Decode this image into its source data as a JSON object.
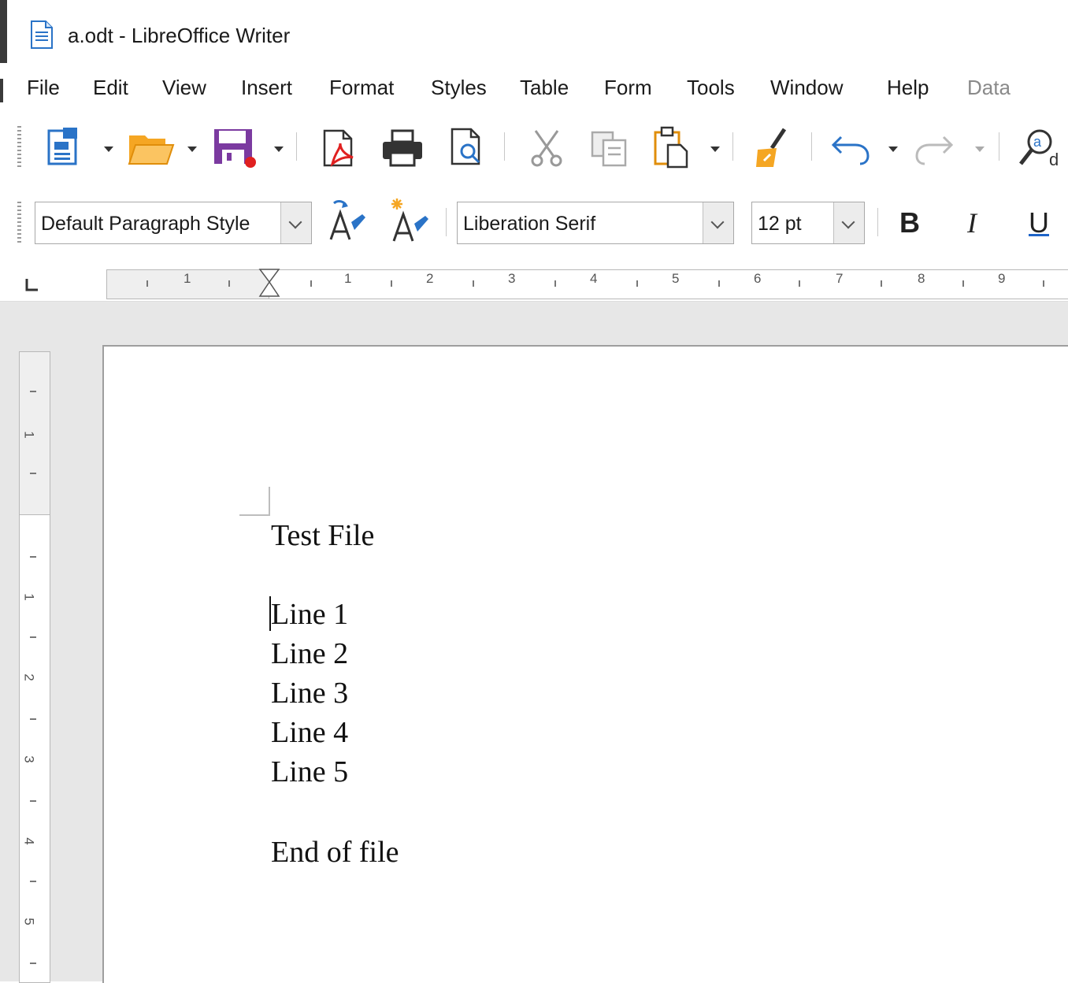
{
  "window": {
    "title": "a.odt - LibreOffice Writer",
    "app_icon": "writer-document-icon"
  },
  "menubar": {
    "items": [
      {
        "label": "File",
        "enabled": true
      },
      {
        "label": "Edit",
        "enabled": true
      },
      {
        "label": "View",
        "enabled": true
      },
      {
        "label": "Insert",
        "enabled": true
      },
      {
        "label": "Format",
        "enabled": true
      },
      {
        "label": "Styles",
        "enabled": true
      },
      {
        "label": "Table",
        "enabled": true
      },
      {
        "label": "Form",
        "enabled": true
      },
      {
        "label": "Tools",
        "enabled": true
      },
      {
        "label": "Window",
        "enabled": true
      },
      {
        "label": "Help",
        "enabled": true
      },
      {
        "label": "Data",
        "enabled": false
      }
    ]
  },
  "standard_toolbar": {
    "icons": [
      "new-document-icon",
      "open-folder-icon",
      "save-icon",
      "export-pdf-icon",
      "print-icon",
      "print-preview-icon",
      "cut-icon",
      "copy-icon",
      "paste-icon",
      "clone-formatting-icon",
      "undo-icon",
      "redo-icon",
      "find-replace-icon"
    ]
  },
  "formatting_toolbar": {
    "paragraph_style": "Default Paragraph Style",
    "font_name": "Liberation Serif",
    "font_size": "12 pt",
    "bold_label": "B",
    "italic_label": "I",
    "underline_label": "U"
  },
  "ruler": {
    "horizontal_labels": [
      "1",
      "1",
      "2",
      "3",
      "4",
      "5",
      "6",
      "7",
      "8",
      "9"
    ],
    "vertical_labels": [
      "1",
      "1",
      "2",
      "3",
      "4",
      "5"
    ]
  },
  "document": {
    "lines": [
      "Test File",
      "",
      "Line 1",
      "Line 2",
      "Line 3",
      "Line 4",
      "Line 5",
      "",
      "End of file"
    ]
  },
  "colors": {
    "accent_orange": "#f5a623",
    "save_purple": "#7b3aa0",
    "underline_blue": "#1e64c8",
    "page_border": "#9e9e9e",
    "workspace": "#e7e7e7"
  }
}
